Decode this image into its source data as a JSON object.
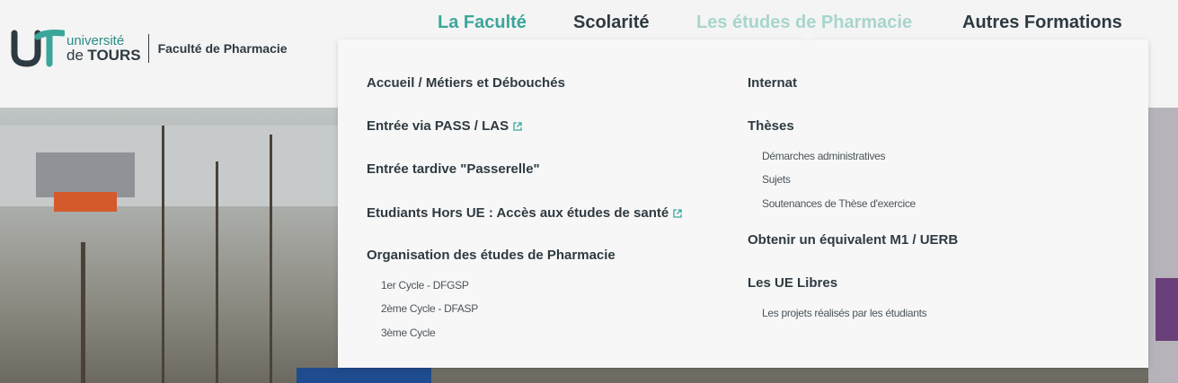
{
  "logo": {
    "universite": "université",
    "de": "de",
    "tours": "TOURS",
    "faculty": "Faculté de Pharmacie"
  },
  "nav": [
    {
      "label": "La Faculté"
    },
    {
      "label": "Scolarité"
    },
    {
      "label": "Les études de Pharmacie"
    },
    {
      "label": "Autres Formations"
    }
  ],
  "menu": {
    "left": {
      "accueil": "Accueil / Métiers et Débouchés",
      "pass": "Entrée via PASS / LAS",
      "passerelle": "Entrée tardive \"Passerelle\"",
      "hors_ue": "Etudiants Hors UE : Accès aux études de santé",
      "organisation": "Organisation des études de Pharmacie",
      "cycle1": "1er Cycle - DFGSP",
      "cycle2": "2ème Cycle - DFASP",
      "cycle3": "3ème Cycle"
    },
    "right": {
      "internat": "Internat",
      "theses": "Thèses",
      "demarches": "Démarches administratives",
      "sujets": "Sujets",
      "soutenances": "Soutenances de Thèse d'exercice",
      "equivalent": "Obtenir un équivalent M1 / UERB",
      "ue_libres": "Les UE Libres",
      "projets": "Les projets réalisés par les étudiants"
    }
  },
  "colors": {
    "accent": "#3ba69a",
    "text": "#2e3a41",
    "hover": "#a8d5cd"
  }
}
